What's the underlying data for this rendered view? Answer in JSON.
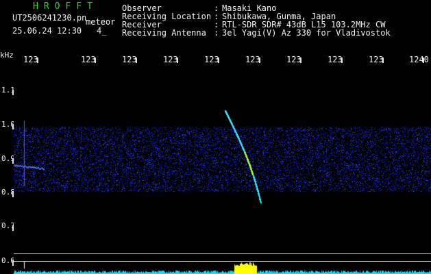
{
  "header": {
    "app_title": "HROFFT",
    "filename": "UT2506241230.pn",
    "meteor_tag": "meteor",
    "datetime": "25.06.24 12:30",
    "count": "4_"
  },
  "info": [
    {
      "label": "Observer",
      "value": "Masaki Kano"
    },
    {
      "label": "Receiving Location",
      "value": "Shibukawa, Gunma, Japan"
    },
    {
      "label": "Receiver",
      "value": "RTL-SDR SDR# 43dB L15 103.2MHz CW"
    },
    {
      "label": "Receiving Antenna",
      "value": "3el Yagi(V) Az 330 for Vladivostok"
    }
  ],
  "separator": ":",
  "chart_data": {
    "type": "heatmap",
    "yunit": "kHz",
    "xticks": [
      "123",
      "123",
      "123",
      "123",
      "123",
      "123",
      "123",
      "123",
      "123",
      "1240"
    ],
    "yticks": [
      "1.1",
      "1.0",
      "0.9",
      "0.8",
      "0.7",
      "0.6"
    ],
    "noise_band_khz": [
      0.8,
      0.99
    ],
    "meteor_trace": {
      "start_khz": 1.04,
      "end_khz": 0.77
    },
    "colors": {
      "noise": "#1a2bff",
      "trace": "#3fe0ff",
      "baseline": "#00e5ff",
      "burst": "#ffff00"
    }
  }
}
